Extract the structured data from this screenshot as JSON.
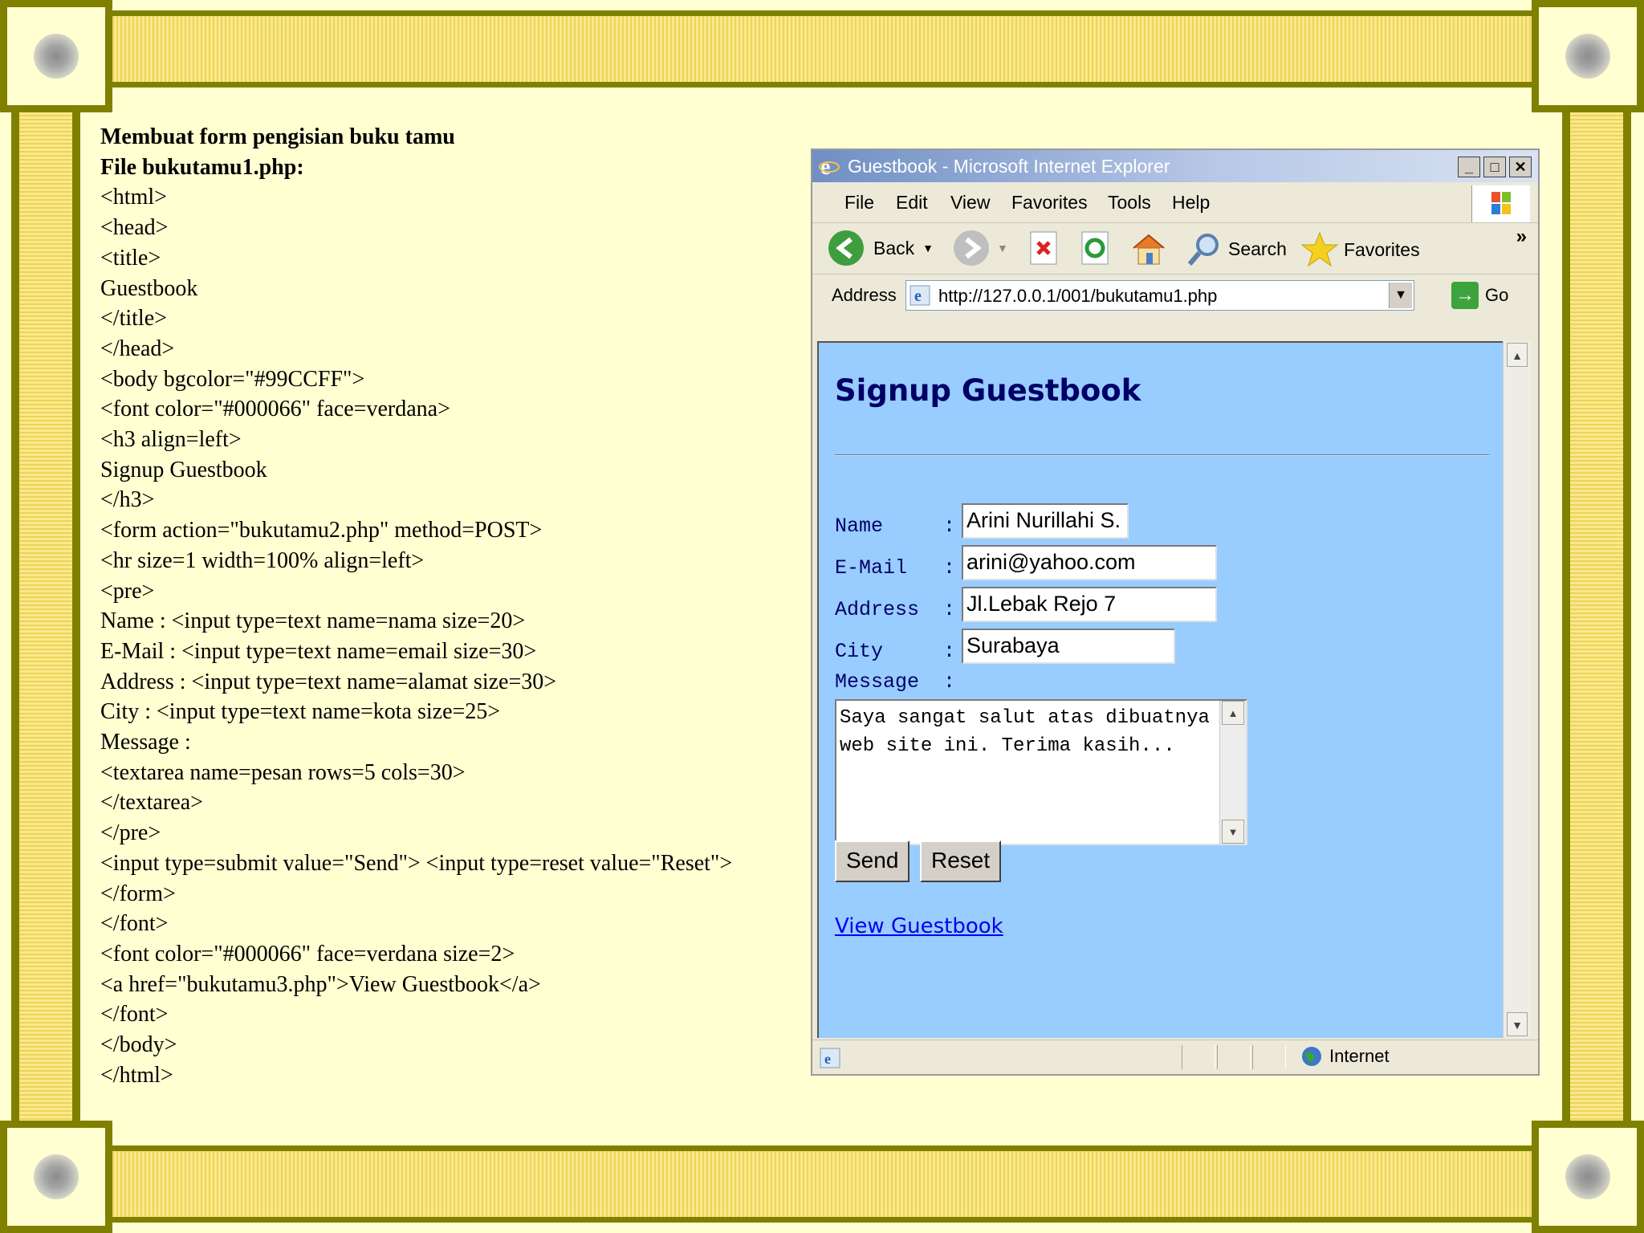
{
  "code": {
    "heading": "Membuat form pengisian buku tamu",
    "file": "File bukutamu1.php:",
    "lines": [
      "<html>",
      "<head>",
      "<title>",
      "Guestbook",
      "</title>",
      "</head>",
      "<body bgcolor=\"#99CCFF\">",
      "<font color=\"#000066\" face=verdana>",
      "<h3 align=left>",
      "Signup Guestbook",
      "</h3>",
      "<form action=\"bukutamu2.php\" method=POST>",
      "<hr size=1 width=100% align=left>",
      "<pre>",
      "Name : <input type=text name=nama size=20>",
      "E-Mail : <input type=text name=email size=30>",
      "Address : <input type=text name=alamat size=30>",
      "City : <input type=text name=kota size=25>",
      "Message :",
      "<textarea name=pesan rows=5 cols=30>",
      "</textarea>",
      "</pre>",
      "<input type=submit value=\"Send\"> <input type=reset value=\"Reset\">",
      "</form>",
      "</font>",
      "<font color=\"#000066\" face=verdana size=2>",
      "<a href=\"bukutamu3.php\">View Guestbook</a>",
      "</font>",
      "</body>",
      "</html>"
    ]
  },
  "browser": {
    "title": "Guestbook - Microsoft Internet Explorer",
    "menu": [
      "File",
      "Edit",
      "View",
      "Favorites",
      "Tools",
      "Help"
    ],
    "toolbar": {
      "back": "Back",
      "search": "Search",
      "favorites": "Favorites",
      "more": "»"
    },
    "address_label": "Address",
    "url": "http://127.0.0.1/001/bukutamu1.php",
    "go": "Go",
    "status_zone": "Internet"
  },
  "form": {
    "heading": "Signup Guestbook",
    "fields": [
      {
        "label": "Name     :",
        "value": "Arini Nurillahi S. P."
      },
      {
        "label": "E-Mail   :",
        "value": "arini@yahoo.com"
      },
      {
        "label": "Address  :",
        "value": "Jl.Lebak Rejo 7"
      },
      {
        "label": "City     :",
        "value": "Surabaya"
      }
    ],
    "message_label": "Message  :",
    "message": "Saya sangat salut atas dibuatnya web site ini. Terima kasih...",
    "send": "Send",
    "reset": "Reset",
    "link": "View Guestbook"
  },
  "colors": {
    "slide_bg": "#FFFFD2",
    "frame": "#808000",
    "page_bg": "#99CCFF",
    "heading": "#000066",
    "link": "#0000EE"
  }
}
